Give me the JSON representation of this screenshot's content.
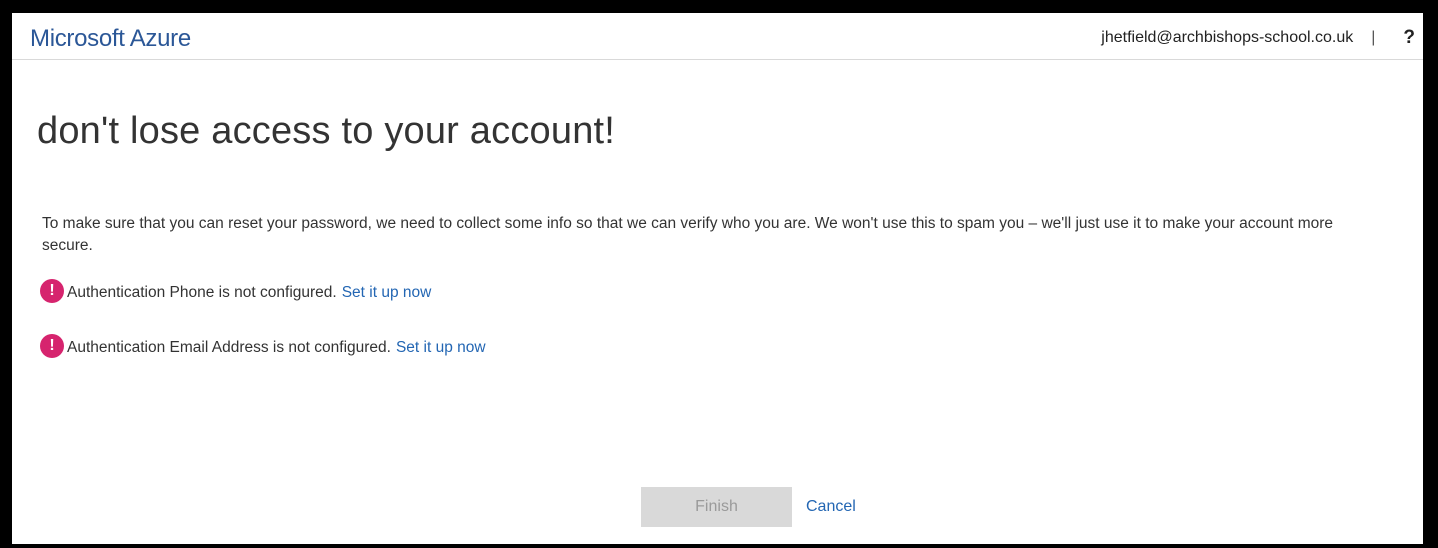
{
  "header": {
    "brand": "Microsoft Azure",
    "user_email": "jhetfield@archbishops-school.co.uk",
    "separator": "|",
    "help_label": "?"
  },
  "main": {
    "title": "don't lose access to your account!",
    "intro": "To make sure that you can reset your password, we need to collect some info so that we can verify who you are. We won't use this to spam you – we'll just use it to make your account more secure.",
    "warnings": [
      {
        "icon": "exclamation-circle-icon",
        "text": "Authentication Phone is not configured.",
        "link": "Set it up now"
      },
      {
        "icon": "exclamation-circle-icon",
        "text": "Authentication Email Address is not configured.",
        "link": "Set it up now"
      }
    ]
  },
  "actions": {
    "finish_label": "Finish",
    "finish_disabled": true,
    "cancel_label": "Cancel"
  },
  "colors": {
    "brand": "#2b5797",
    "link": "#2366b3",
    "warning_icon": "#d6246e",
    "disabled_button": "#d9d9d9"
  }
}
